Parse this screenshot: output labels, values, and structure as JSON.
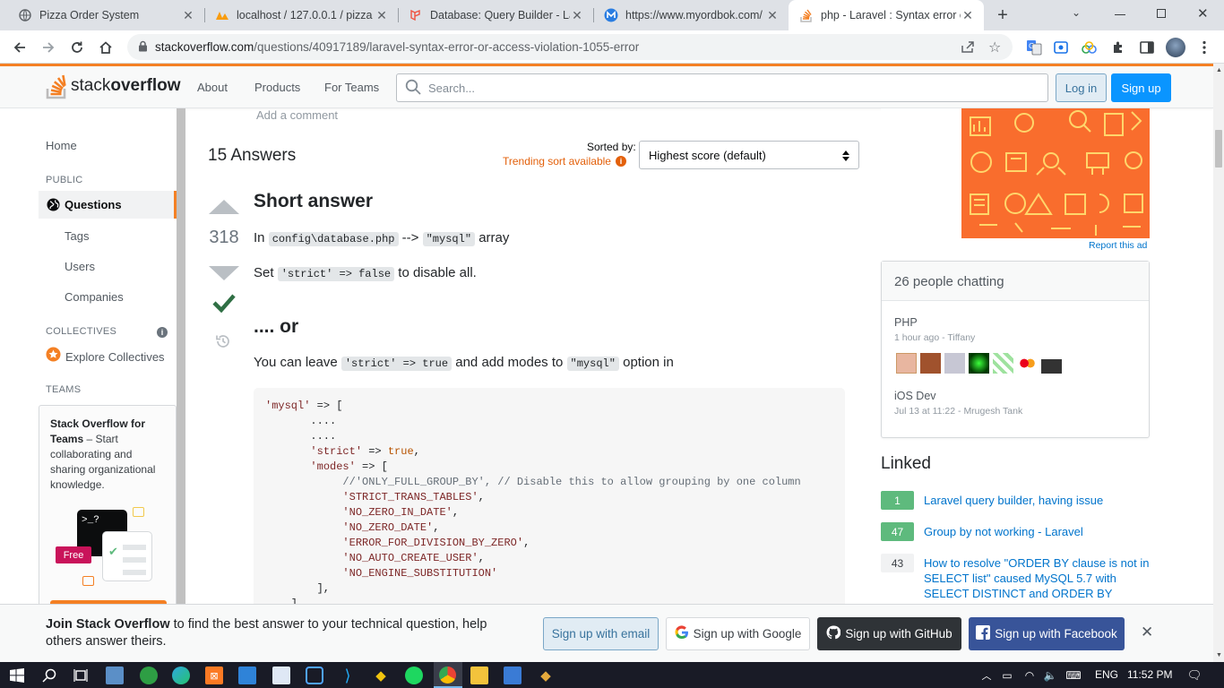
{
  "browser": {
    "tabs": [
      {
        "title": "Pizza Order System",
        "icon": "globe-icon",
        "active": false
      },
      {
        "title": "localhost / 127.0.0.1 / pizza /",
        "icon": "phpmyadmin-icon",
        "active": false
      },
      {
        "title": "Database: Query Builder - La",
        "icon": "laravel-icon",
        "active": false
      },
      {
        "title": "https://www.myordbok.com/",
        "icon": "myordbok-icon",
        "active": false
      },
      {
        "title": "php - Laravel : Syntax error o",
        "icon": "stackoverflow-icon",
        "active": true
      }
    ],
    "url_domain": "stackoverflow.com",
    "url_path": "/questions/40917189/laravel-syntax-error-or-access-violation-1055-error"
  },
  "so_header": {
    "logo_text_a": "stack",
    "logo_text_b": "overflow",
    "nav": [
      "About",
      "Products",
      "For Teams"
    ],
    "search_placeholder": "Search...",
    "login": "Log in",
    "signup": "Sign up"
  },
  "left_nav": {
    "home": "Home",
    "public_heading": "PUBLIC",
    "questions": "Questions",
    "tags": "Tags",
    "users": "Users",
    "companies": "Companies",
    "collectives_heading": "COLLECTIVES",
    "explore_collectives": "Explore Collectives",
    "teams_heading": "TEAMS",
    "teams_title": "Stack Overflow for Teams",
    "teams_rest": " – Start collaborating and sharing organizational knowledge.",
    "free_badge": "Free",
    "terminal_text": ">_?"
  },
  "answers": {
    "add_comment": "Add a comment",
    "count_label": "15 Answers",
    "sorted_by": "Sorted by:",
    "trending": "Trending sort available",
    "sort_value": "Highest score (default)",
    "vote_score": "318",
    "heading1": "Short answer",
    "p1_a": "In ",
    "p1_code1": "config\\database.php",
    "p1_b": " --> ",
    "p1_code2": "\"mysql\"",
    "p1_c": " array",
    "p2_a": "Set ",
    "p2_code": "'strict' => false",
    "p2_b": " to disable all.",
    "heading2": ".... or",
    "p3_a": "You can leave ",
    "p3_code1": "'strict' => true",
    "p3_b": " and add modes to ",
    "p3_code2": "\"mysql\"",
    "p3_c": " option in",
    "code_lines": [
      {
        "parts": [
          {
            "t": "'mysql'",
            "c": "ks"
          },
          {
            "t": " => [",
            "c": ""
          }
        ]
      },
      {
        "parts": [
          {
            "t": "       ....",
            "c": ""
          }
        ]
      },
      {
        "parts": [
          {
            "t": "       ....",
            "c": ""
          }
        ]
      },
      {
        "parts": [
          {
            "t": "       ",
            "c": ""
          },
          {
            "t": "'strict'",
            "c": "ks"
          },
          {
            "t": " => ",
            "c": ""
          },
          {
            "t": "true",
            "c": "kn"
          },
          {
            "t": ",",
            "c": ""
          }
        ]
      },
      {
        "parts": [
          {
            "t": "       ",
            "c": ""
          },
          {
            "t": "'modes'",
            "c": "ks"
          },
          {
            "t": " => [",
            "c": ""
          }
        ]
      },
      {
        "parts": [
          {
            "t": "            ",
            "c": ""
          },
          {
            "t": "//'ONLY_FULL_GROUP_BY', // Disable this to allow grouping by one column",
            "c": "kc"
          }
        ]
      },
      {
        "parts": [
          {
            "t": "            ",
            "c": ""
          },
          {
            "t": "'STRICT_TRANS_TABLES'",
            "c": "ks"
          },
          {
            "t": ",",
            "c": ""
          }
        ]
      },
      {
        "parts": [
          {
            "t": "            ",
            "c": ""
          },
          {
            "t": "'NO_ZERO_IN_DATE'",
            "c": "ks"
          },
          {
            "t": ",",
            "c": ""
          }
        ]
      },
      {
        "parts": [
          {
            "t": "            ",
            "c": ""
          },
          {
            "t": "'NO_ZERO_DATE'",
            "c": "ks"
          },
          {
            "t": ",",
            "c": ""
          }
        ]
      },
      {
        "parts": [
          {
            "t": "            ",
            "c": ""
          },
          {
            "t": "'ERROR_FOR_DIVISION_BY_ZERO'",
            "c": "ks"
          },
          {
            "t": ",",
            "c": ""
          }
        ]
      },
      {
        "parts": [
          {
            "t": "            ",
            "c": ""
          },
          {
            "t": "'NO_AUTO_CREATE_USER'",
            "c": "ks"
          },
          {
            "t": ",",
            "c": ""
          }
        ]
      },
      {
        "parts": [
          {
            "t": "            ",
            "c": ""
          },
          {
            "t": "'NO_ENGINE_SUBSTITUTION'",
            "c": "ks"
          }
        ]
      },
      {
        "parts": [
          {
            "t": "        ],",
            "c": ""
          }
        ]
      },
      {
        "parts": [
          {
            "t": "    ]",
            "c": ""
          }
        ]
      }
    ]
  },
  "right_sidebar": {
    "report_ad": "Report this ad",
    "chat_title": "26 people chatting",
    "room1_name": "PHP",
    "room1_meta": "1 hour ago - Tiffany",
    "room2_name": "iOS Dev",
    "room2_meta": "Jul 13 at 11:22 - Mrugesh Tank",
    "linked_title": "Linked",
    "linked": [
      {
        "score": "1",
        "title": "Laravel query builder, having issue",
        "accepted": true
      },
      {
        "score": "47",
        "title": "Group by not working - Laravel",
        "accepted": true
      },
      {
        "score": "43",
        "title": "How to resolve \"ORDER BY clause is not in SELECT list\" caused MySQL 5.7 with SELECT DISTINCT and ORDER BY",
        "accepted": false
      }
    ]
  },
  "banner": {
    "bold": "Join Stack Overflow",
    "rest": " to find the best answer to your technical question, help others answer theirs.",
    "email": "Sign up with email",
    "google": "Sign up with Google",
    "github": "Sign up with GitHub",
    "facebook": "Sign up with Facebook"
  },
  "taskbar": {
    "lang": "ENG",
    "time": "11:52 PM"
  },
  "colors": {
    "so_orange": "#f48024",
    "so_blue": "#0a95ff",
    "accepted_green": "#2f6f44",
    "linked_green": "#5eba7d",
    "ad_orange": "#f96d2d"
  }
}
